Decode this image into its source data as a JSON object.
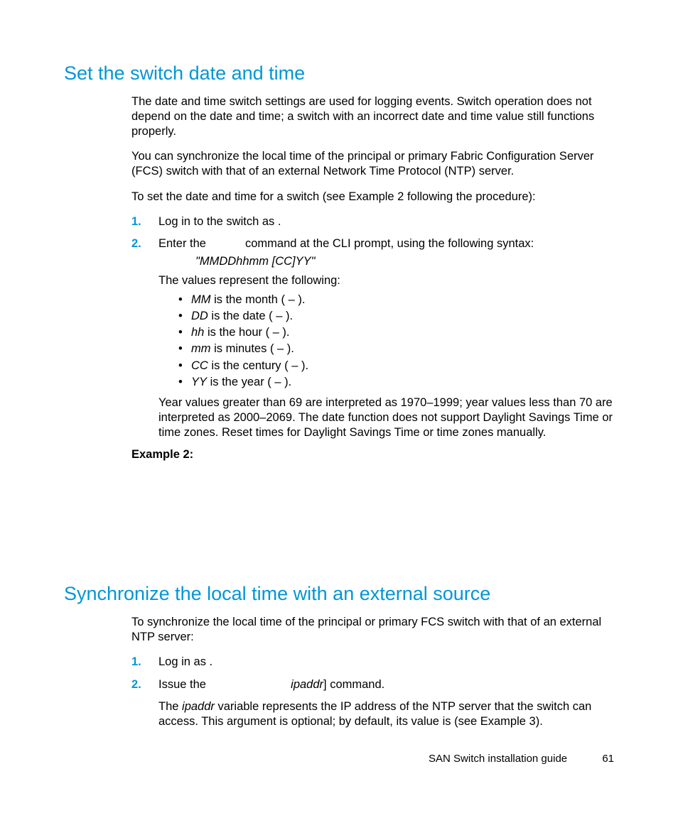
{
  "section1": {
    "heading": "Set the switch date and time",
    "p1": "The date and time switch settings are used for logging events. Switch operation does not depend on the date and time; a switch with an incorrect date and time value still functions properly.",
    "p2": "You can synchronize the local time of the principal or primary Fabric Configuration Server (FCS) switch with that of an external Network Time Protocol (NTP) server.",
    "p3": "To set the date and time for a switch (see Example 2 following the procedure):",
    "step1_num": "1.",
    "step1": "Log in to the switch as           .",
    "step2_num": "2.",
    "step2_a": "Enter the ",
    "step2_b": " command at the CLI prompt, using the following syntax:",
    "syntax": "\"MMDDhhmm [CC]YY\"",
    "values_intro": "The values represent the following:",
    "bullets": [
      {
        "code": "MM",
        "text": " is the month (     –     )."
      },
      {
        "code": "DD",
        "text": " is the date (     –     )."
      },
      {
        "code": "hh",
        "text": " is the hour (     –     )."
      },
      {
        "code": "mm",
        "text": " is minutes (     –     )."
      },
      {
        "code": "CC",
        "text": " is the century (     –     )."
      },
      {
        "code": "YY",
        "text": " is the year (     –     )."
      }
    ],
    "year_note": "Year values greater than 69 are interpreted as 1970–1999; year values less than 70 are interpreted as 2000–2069. The date function does not support Daylight Savings Time or time zones. Reset times for Daylight Savings Time or time zones manually.",
    "example_label": "Example 2:"
  },
  "section2": {
    "heading": "Synchronize the local time with an external source",
    "p1": "To synchronize the local time of the principal or primary FCS switch with that of an external NTP server:",
    "step1_num": "1.",
    "step1": "Log in as           .",
    "step2_num": "2.",
    "step2_a": "Issue the ",
    "step2_ip": "ipaddr",
    "step2_b": "] command.",
    "step2_note_a": "The ",
    "step2_note_ip": "ipaddr",
    "step2_note_b": " variable represents the IP address of the NTP server that the switch can access. This argument is optional; by default, its value is           (see Example 3)."
  },
  "footer": {
    "title": "SAN Switch installation guide",
    "page": "61"
  }
}
